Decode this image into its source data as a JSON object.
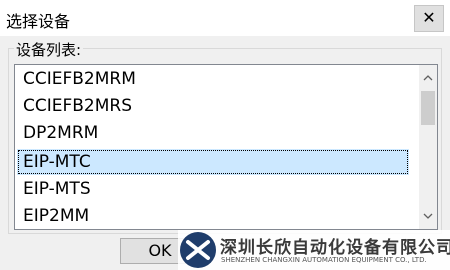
{
  "dialog": {
    "title": "选择设备",
    "close_glyph": "✕",
    "group_label": "设备列表:",
    "devices": [
      "CCIEFB2MRM",
      "CCIEFB2MRS",
      "DP2MRM",
      "EIP-MTC",
      "EIP-MTS",
      "EIP2MM"
    ],
    "selected": "EIP-MTC",
    "ok_label": "OK"
  },
  "scrollbar": {
    "up_icon": "chevron-up-icon",
    "down_icon": "chevron-down-icon",
    "position_fraction": 0.1
  },
  "watermark": {
    "company_cn": "深圳长欣自动化设备有限公司",
    "company_en": "SHENZHEN CHANGXIN AUTOMATION EQUIPMENT CO., LTD."
  }
}
